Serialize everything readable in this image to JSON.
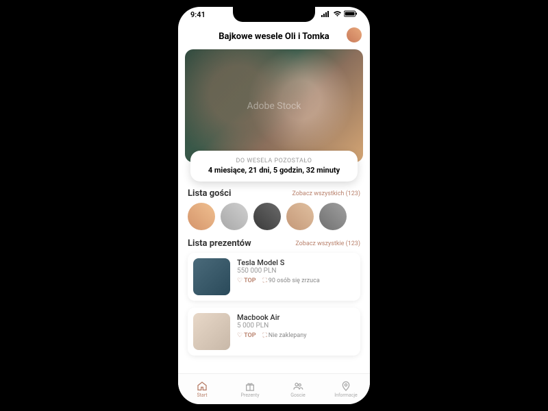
{
  "status": {
    "time": "9:41"
  },
  "header": {
    "title": "Bajkowe wesele Oli i Tomka"
  },
  "hero": {
    "watermark": "Adobe Stock"
  },
  "countdown": {
    "label": "DO WESELA POZOSTAŁO",
    "time": "4 miesiące, 21 dni, 5 godzin, 32 minuty"
  },
  "guests": {
    "title": "Lista gości",
    "view_all": "Zobacz wszystkich (123)"
  },
  "gifts": {
    "title": "Lista prezentów",
    "view_all": "Zobacz wszystkie (123)",
    "items": [
      {
        "name": "Tesla Model S",
        "price": "550 000 PLN",
        "top": "TOP",
        "status": "90 osób się zrzuca"
      },
      {
        "name": "Macbook Air",
        "price": "5 000 PLN",
        "top": "TOP",
        "status": "Nie zaklepany"
      }
    ]
  },
  "tabs": {
    "start": "Start",
    "prezenty": "Prezenty",
    "goscie": "Goscie",
    "informacje": "Informacje"
  }
}
